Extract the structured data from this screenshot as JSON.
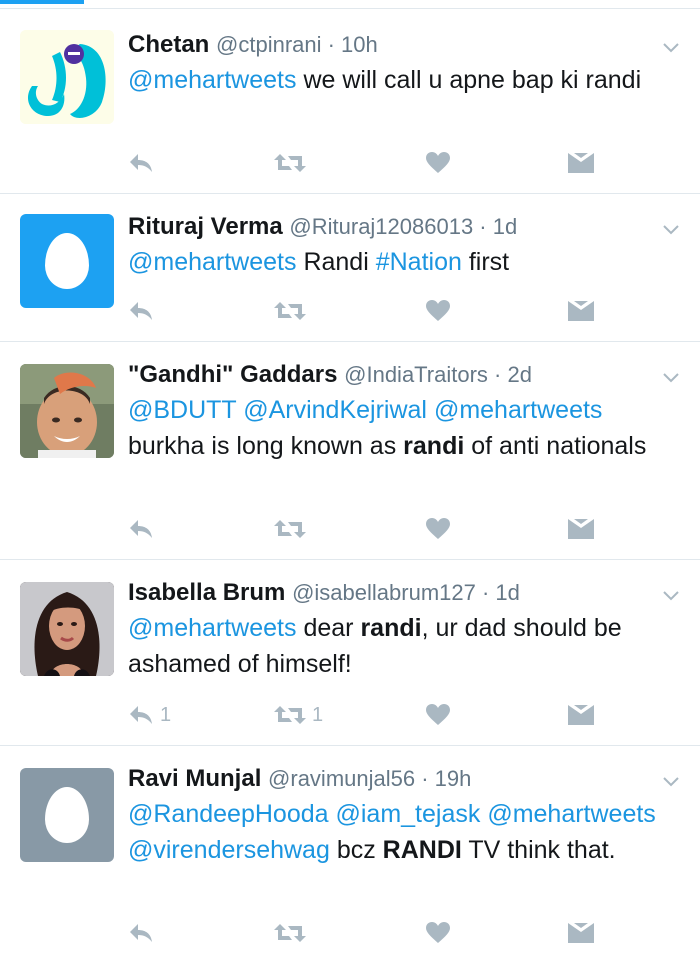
{
  "colors": {
    "accent": "#1da1f2",
    "link": "#1b95e0",
    "muted": "#657786",
    "icon": "#aab8c2",
    "egg_bg_blue": "#1da1f2",
    "egg_bg_gray": "#8899a6"
  },
  "tweets": [
    {
      "name": "Chetan",
      "handle": "@ctpinrani · 10h",
      "segments": [
        {
          "text": "@mehartweets",
          "kind": "mention"
        },
        {
          "text": " we will call u apne bap ki randi",
          "kind": "text"
        }
      ],
      "reply_count": "",
      "retweet_count": "",
      "icons": [
        "reply-icon",
        "retweet-icon",
        "like-icon",
        "dm-icon",
        "chevron-down-icon"
      ]
    },
    {
      "name": "Rituraj Verma",
      "handle": "@Rituraj12086013 · 1d",
      "segments": [
        {
          "text": "@mehartweets",
          "kind": "mention"
        },
        {
          "text": " Randi ",
          "kind": "text"
        },
        {
          "text": "#Nation",
          "kind": "hashtag"
        },
        {
          "text": " first",
          "kind": "text"
        }
      ],
      "reply_count": "",
      "retweet_count": ""
    },
    {
      "name": "\"Gandhi\" Gaddars",
      "handle": "@IndiaTraitors · 2d",
      "segments": [
        {
          "text": "@BDUTT",
          "kind": "mention"
        },
        {
          "text": " ",
          "kind": "text"
        },
        {
          "text": "@ArvindKejriwal",
          "kind": "mention"
        },
        {
          "text": " ",
          "kind": "text"
        },
        {
          "text": "@mehartweets",
          "kind": "mention"
        },
        {
          "text": " burkha is long known as ",
          "kind": "text"
        },
        {
          "text": "randi",
          "kind": "strong"
        },
        {
          "text": " of anti nationals",
          "kind": "text"
        }
      ],
      "reply_count": "",
      "retweet_count": ""
    },
    {
      "name": "Isabella Brum",
      "handle": "@isabellabrum127 · 1d",
      "segments": [
        {
          "text": "@mehartweets",
          "kind": "mention"
        },
        {
          "text": " dear ",
          "kind": "text"
        },
        {
          "text": "randi",
          "kind": "strong"
        },
        {
          "text": ", ur dad should be ashamed of himself!",
          "kind": "text"
        }
      ],
      "reply_count": "1",
      "retweet_count": "1"
    },
    {
      "name": "Ravi Munjal",
      "handle": "@ravimunjal56 · 19h",
      "segments": [
        {
          "text": "@RandeepHooda",
          "kind": "mention"
        },
        {
          "text": " ",
          "kind": "text"
        },
        {
          "text": "@iam_tejask",
          "kind": "mention"
        },
        {
          "text": " ",
          "kind": "text"
        },
        {
          "text": "@mehartweets",
          "kind": "mention"
        },
        {
          "text": " ",
          "kind": "text"
        },
        {
          "text": "@virendersehwag",
          "kind": "mention"
        },
        {
          "text": " bcz ",
          "kind": "text"
        },
        {
          "text": "RANDI",
          "kind": "strong"
        },
        {
          "text": " TV think that.",
          "kind": "text"
        }
      ],
      "reply_count": "",
      "retweet_count": ""
    }
  ]
}
